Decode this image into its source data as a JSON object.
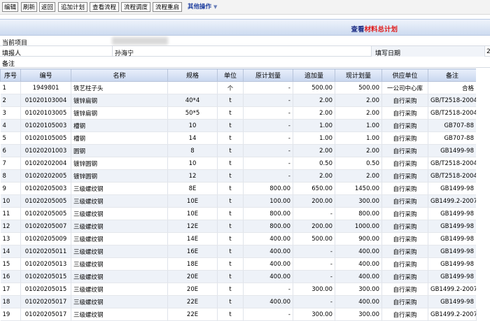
{
  "toolbar": {
    "buttons": [
      "编辑",
      "刷新",
      "返回",
      "追加计划",
      "查看流程",
      "流程调度",
      "流程重启"
    ],
    "other_label": "其他操作"
  },
  "title": {
    "prefix": "查看",
    "highlight": "材料总计划"
  },
  "info": {
    "current_project_label": "当前项目",
    "reporter_label": "填报人",
    "reporter_value": "孙海宁",
    "fill_date_label": "填写日期",
    "fill_date_value": "2",
    "remark_label": "备注"
  },
  "table": {
    "headers": [
      "序号",
      "编号",
      "名称",
      "规格",
      "单位",
      "原计划量",
      "追加量",
      "现计划量",
      "供应单位",
      "备注"
    ],
    "rows": [
      [
        "1",
        "1949801",
        "铁艺柱子头",
        "",
        "个",
        "-",
        "500.00",
        "500.00",
        "一公司中心库",
        "合格"
      ],
      [
        "2",
        "01020103004",
        "镀锌扁钢",
        "40*4",
        "t",
        "-",
        "2.00",
        "2.00",
        "自行采购",
        "GB/T2518-2004"
      ],
      [
        "3",
        "01020103005",
        "镀锌扁钢",
        "50*5",
        "t",
        "-",
        "2.00",
        "2.00",
        "自行采购",
        "GB/T2518-2004"
      ],
      [
        "4",
        "01020105003",
        "槽钢",
        "10",
        "t",
        "-",
        "1.00",
        "1.00",
        "自行采购",
        "GB707-88"
      ],
      [
        "5",
        "01020105005",
        "槽钢",
        "14",
        "t",
        "-",
        "1.00",
        "1.00",
        "自行采购",
        "GB707-88"
      ],
      [
        "6",
        "01020201003",
        "圆钢",
        "8",
        "t",
        "-",
        "2.00",
        "2.00",
        "自行采购",
        "GB1499-98"
      ],
      [
        "7",
        "01020202004",
        "镀锌圆钢",
        "10",
        "t",
        "-",
        "0.50",
        "0.50",
        "自行采购",
        "GB/T2518-2004"
      ],
      [
        "8",
        "01020202005",
        "镀锌圆钢",
        "12",
        "t",
        "-",
        "2.00",
        "2.00",
        "自行采购",
        "GB/T2518-2004"
      ],
      [
        "9",
        "01020205003",
        "三级螺纹钢",
        "8E",
        "t",
        "800.00",
        "650.00",
        "1450.00",
        "自行采购",
        "GB1499-98"
      ],
      [
        "10",
        "01020205005",
        "三级螺纹钢",
        "10E",
        "t",
        "100.00",
        "200.00",
        "300.00",
        "自行采购",
        "GB1499.2-2007"
      ],
      [
        "11",
        "01020205005",
        "三级螺纹钢",
        "10E",
        "t",
        "800.00",
        "-",
        "800.00",
        "自行采购",
        "GB1499-98"
      ],
      [
        "12",
        "01020205007",
        "三级螺纹钢",
        "12E",
        "t",
        "800.00",
        "200.00",
        "1000.00",
        "自行采购",
        "GB1499-98"
      ],
      [
        "13",
        "01020205009",
        "三级螺纹钢",
        "14E",
        "t",
        "400.00",
        "500.00",
        "900.00",
        "自行采购",
        "GB1499-98"
      ],
      [
        "14",
        "01020205011",
        "三级螺纹钢",
        "16E",
        "t",
        "400.00",
        "-",
        "400.00",
        "自行采购",
        "GB1499-98"
      ],
      [
        "15",
        "01020205013",
        "三级螺纹钢",
        "18E",
        "t",
        "400.00",
        "-",
        "400.00",
        "自行采购",
        "GB1499-98"
      ],
      [
        "16",
        "01020205015",
        "三级螺纹钢",
        "20E",
        "t",
        "400.00",
        "-",
        "400.00",
        "自行采购",
        "GB1499-98"
      ],
      [
        "17",
        "01020205015",
        "三级螺纹钢",
        "20E",
        "t",
        "-",
        "300.00",
        "300.00",
        "自行采购",
        "GB1499.2-2007"
      ],
      [
        "18",
        "01020205017",
        "三级螺纹钢",
        "22E",
        "t",
        "400.00",
        "-",
        "400.00",
        "自行采购",
        "GB1499-98"
      ],
      [
        "19",
        "01020205017",
        "三级螺纹钢",
        "22E",
        "t",
        "-",
        "300.00",
        "300.00",
        "自行采购",
        "GB1499.2-2007"
      ]
    ]
  }
}
